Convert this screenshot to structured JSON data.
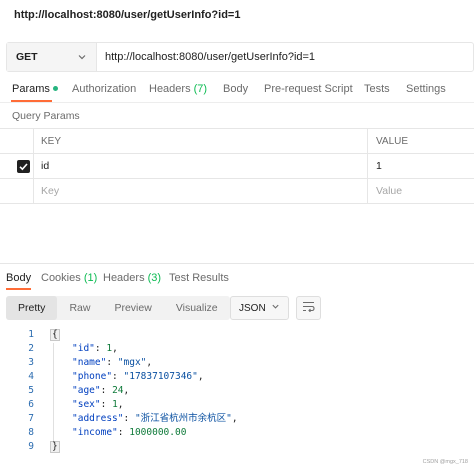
{
  "window": {
    "title": "http://localhost:8080/user/getUserInfo?id=1"
  },
  "request": {
    "method": "GET",
    "url": "http://localhost:8080/user/getUserInfo?id=1"
  },
  "request_tabs": {
    "params": "Params",
    "authorization": "Authorization",
    "headers": "Headers",
    "headers_count": "(7)",
    "body": "Body",
    "prerequest": "Pre-request Script",
    "tests": "Tests",
    "settings": "Settings"
  },
  "query_params": {
    "label": "Query Params",
    "col_key": "KEY",
    "col_value": "VALUE",
    "rows": [
      {
        "key": "id",
        "value": "1",
        "checked": true
      }
    ],
    "placeholder_key": "Key",
    "placeholder_value": "Value"
  },
  "response_tabs": {
    "body": "Body",
    "cookies": "Cookies",
    "cookies_count": "(1)",
    "headers": "Headers",
    "headers_count": "(3)",
    "test_results": "Test Results"
  },
  "view_modes": {
    "pretty": "Pretty",
    "raw": "Raw",
    "preview": "Preview",
    "visualize": "Visualize"
  },
  "format": "JSON",
  "code_lines": {
    "n1": "1",
    "n2": "2",
    "n3": "3",
    "n4": "4",
    "n5": "5",
    "n6": "6",
    "n7": "7",
    "n8": "8",
    "n9": "9",
    "open": "{",
    "close": "}",
    "id_key": "\"id\"",
    "id_val": "1",
    "name_key": "\"name\"",
    "name_val": "\"mgx\"",
    "phone_key": "\"phone\"",
    "phone_val": "\"17837107346\"",
    "age_key": "\"age\"",
    "age_val": "24",
    "sex_key": "\"sex\"",
    "sex_val": "1",
    "address_key": "\"address\"",
    "address_val": "\"浙江省杭州市余杭区\"",
    "income_key": "\"income\"",
    "income_val": "1000000.00"
  },
  "watermark": "CSDN @mgx_718",
  "colors": {
    "accent": "#ff6c37",
    "status_green": "#0cbb52",
    "json_key": "#003fbf"
  }
}
